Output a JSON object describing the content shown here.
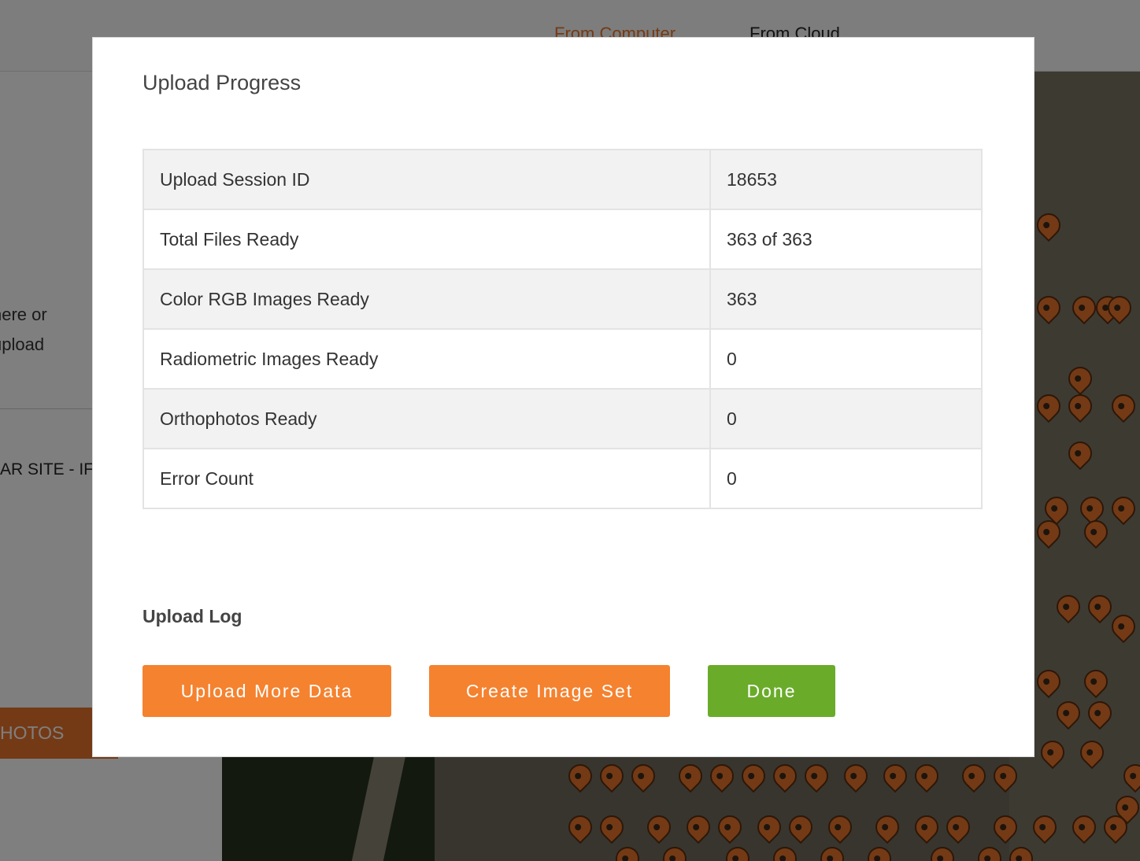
{
  "background": {
    "tabs": [
      "From Computer",
      "From Cloud"
    ],
    "drop_hint_lines": [
      "here or",
      "upload"
    ],
    "site_name": "AR SITE - IF",
    "photos_button": "HOTOS"
  },
  "modal": {
    "title": "Upload Progress",
    "rows": [
      {
        "label": "Upload Session ID",
        "value": "18653"
      },
      {
        "label": "Total Files Ready",
        "value": "363 of 363"
      },
      {
        "label": "Color RGB Images Ready",
        "value": "363"
      },
      {
        "label": "Radiometric Images Ready",
        "value": "0"
      },
      {
        "label": "Orthophotos Ready",
        "value": "0"
      },
      {
        "label": "Error Count",
        "value": "0"
      }
    ],
    "log_title": "Upload Log",
    "buttons": {
      "upload_more": "Upload More Data",
      "create_set": "Create Image Set",
      "done": "Done"
    }
  },
  "colors": {
    "accent_orange": "#f5822f",
    "done_green": "#6aac2a",
    "map_pin": "#e8752a"
  },
  "icons": [
    "map-pin-icon"
  ]
}
